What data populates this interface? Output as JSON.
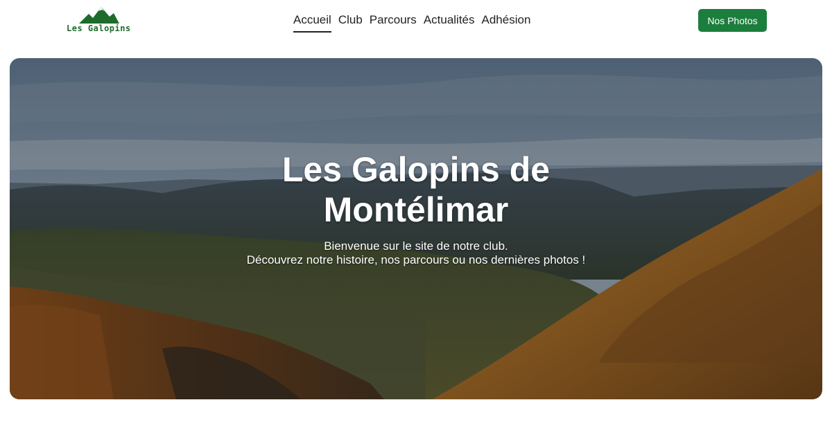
{
  "header": {
    "logo_text": "Les Galopins",
    "logo_icon": "mountain-icon",
    "nav": [
      {
        "label": "Accueil",
        "active": true
      },
      {
        "label": "Club",
        "active": false
      },
      {
        "label": "Parcours",
        "active": false
      },
      {
        "label": "Actualités",
        "active": false
      },
      {
        "label": "Adhésion",
        "active": false
      }
    ],
    "photos_button": "Nos Photos"
  },
  "hero": {
    "title_line1": "Les Galopins de",
    "title_line2": "Montélimar",
    "subtitle_line1": "Bienvenue sur le site de notre club.",
    "subtitle_line2": "Découvrez notre histoire, nos parcours ou nos dernières photos !"
  },
  "colors": {
    "brand_green": "#1b7e3c",
    "logo_green": "#1e6b2c",
    "nav_text": "#222222"
  }
}
